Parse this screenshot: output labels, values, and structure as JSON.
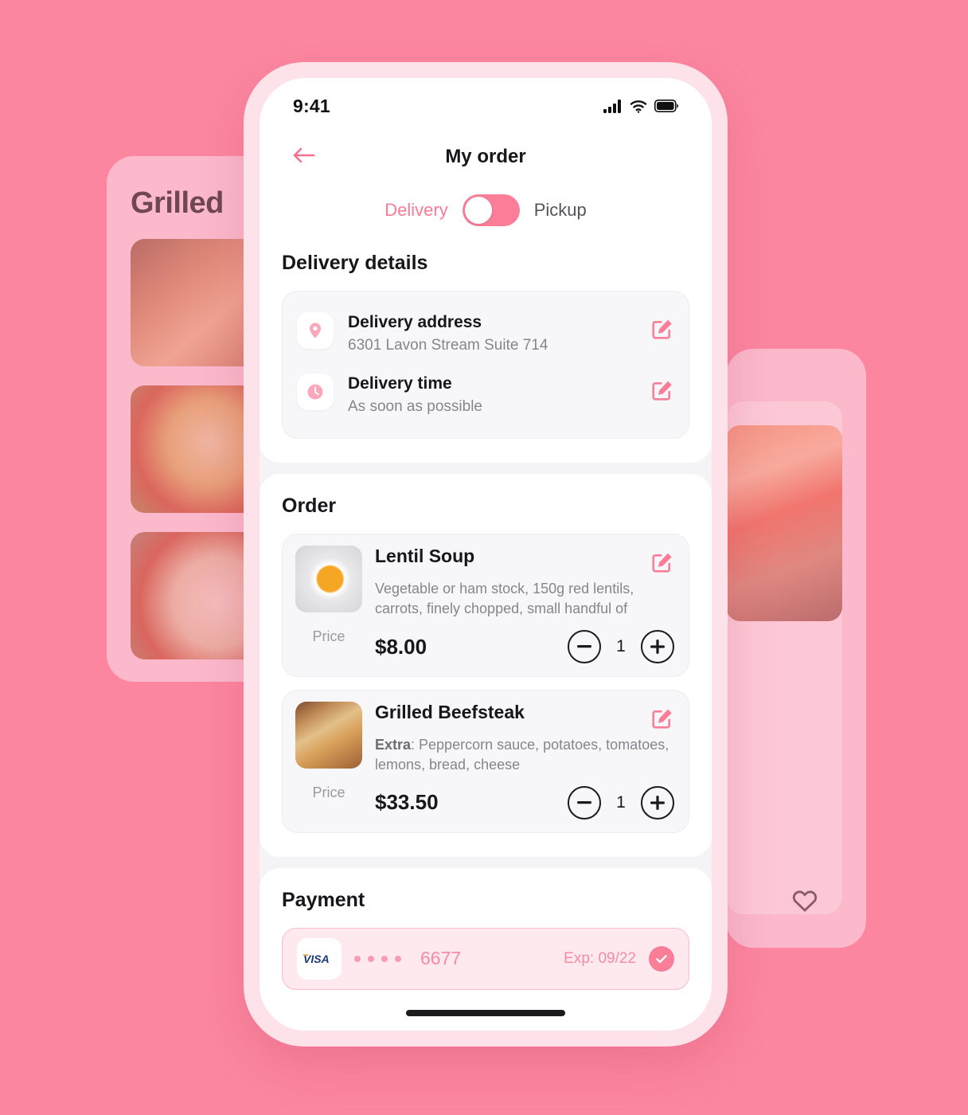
{
  "theme": {
    "background": "#FC86A0",
    "accent": "#FB7E99",
    "card_bg": "#FFFFFF",
    "muted_text": "#86858D",
    "dark_text": "#17161A"
  },
  "background_cards": {
    "left": {
      "title": "Grilled"
    },
    "right": {
      "favorite_icon": "heart-icon"
    }
  },
  "status_bar": {
    "time": "9:41",
    "icons": [
      "cellular-signal-icon",
      "wifi-icon",
      "battery-icon"
    ]
  },
  "nav": {
    "back_icon": "arrow-left-icon",
    "title": "My order"
  },
  "mode_toggle": {
    "left_label": "Delivery",
    "right_label": "Pickup",
    "selected": "Delivery"
  },
  "delivery_details": {
    "title": "Delivery details",
    "rows": [
      {
        "icon": "location-pin-icon",
        "title": "Delivery address",
        "value": "6301 Lavon Stream Suite 714",
        "edit_icon": "edit-icon"
      },
      {
        "icon": "clock-icon",
        "title": "Delivery time",
        "value": "As soon as possible",
        "edit_icon": "edit-icon"
      }
    ]
  },
  "order": {
    "title": "Order",
    "price_label": "Price",
    "items": [
      {
        "name": "Lentil Soup",
        "description": "Vegetable or ham stock, 150g red lentils, carrots, finely chopped, small handful of chop...",
        "description_prefix": "",
        "price": "$8.00",
        "quantity": "1",
        "price_label": "Price",
        "edit_icon": "edit-icon",
        "thumb": "lentil-soup-photo"
      },
      {
        "name": "Grilled Beefsteak",
        "description": ": Peppercorn sauce, potatoes, tomatoes, lemons, bread, cheese",
        "description_prefix": "Extra",
        "price": "$33.50",
        "quantity": "1",
        "price_label": "Price",
        "edit_icon": "edit-icon",
        "thumb": "grilled-beefsteak-photo"
      }
    ]
  },
  "payment": {
    "title": "Payment",
    "card": {
      "brand": "VISA",
      "masked_digits": "6677",
      "expiry": "Exp: 09/22",
      "selected": true,
      "check_icon": "check-circle-icon"
    }
  }
}
